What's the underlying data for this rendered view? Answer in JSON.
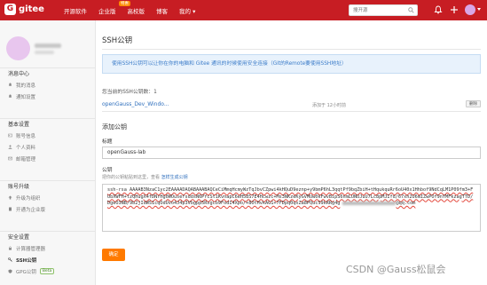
{
  "header": {
    "brand": "gitee",
    "logo_letter": "G",
    "nav": [
      "开源软件",
      "企业版",
      "高校版",
      "博客",
      "我的"
    ],
    "nav_badge": "特惠",
    "search_placeholder": "搜开源",
    "brand_color": "#c71d23"
  },
  "sidebar": {
    "groups": [
      {
        "title": "消息中心",
        "items": [
          "我的消息",
          "通知设置"
        ]
      },
      {
        "title": "基本设置",
        "items": [
          "账号信息",
          "个人资料",
          "邮箱管理"
        ]
      },
      {
        "title": "账号升级",
        "items": [
          "升级为组织",
          "开通为企业版"
        ]
      },
      {
        "title": "安全设置",
        "items": [
          "计算器管理器",
          "SSH公钥",
          "GPG公钥"
        ]
      }
    ],
    "active_item": "SSH公钥",
    "beta": "Beta"
  },
  "main": {
    "title": "SSH公钥",
    "notice": "使用SSH公钥可以让你在你的电脑和 Gitee 通讯的时候使用安全连接（Git的Remote要使用SSH地址）",
    "count": "您当前的SSH公钥数：1",
    "key_name": "openGauss_Dev_Windo...",
    "key_time": "添加于 12小时前",
    "delete_label": "删除",
    "section_title": "添加公钥",
    "title_label": "标题",
    "title_value": "openGauss-lab",
    "key_label": "公钥",
    "hint_text": "把你的公钥粘贴到这里，查看",
    "hint_link": "怎样生成公钥",
    "key_value": "ssh-rsa AAAAB3NzaC1yc2EAAAADAQABAAABAQCeCiMmqHcmyWzTqJbvCZpwi4kHQuD9eznp+y9bmP6hL3qqtPf9bqZbiH+tHqukquRr6oU40x1Hhbof9NdCqLM1P09fm3+FUbXWFH+tzQHugX4fDNrHg0WOusefsddsN6PYcSt1KvnapC6eH58S7E4Hcwzc+Ms3NKzeKyGVMUw0kFwvBipS6nmLUNUJuU7Lc8pMJIfd/67xh2U6mIZwPOf9nYMFkzagTTD/DgeO3NB/9b2jIdWS1cqOdUvo4J4p3Vbgpp5Rxgcb9FodI4Xpo/+8OtHvkAG1+7FDpq0qxZa8PQucS9kRRg4g",
    "key_email_suffix": "@qq.com",
    "submit_label": "确定"
  },
  "watermark": "CSDN @Gauss松鼠会"
}
